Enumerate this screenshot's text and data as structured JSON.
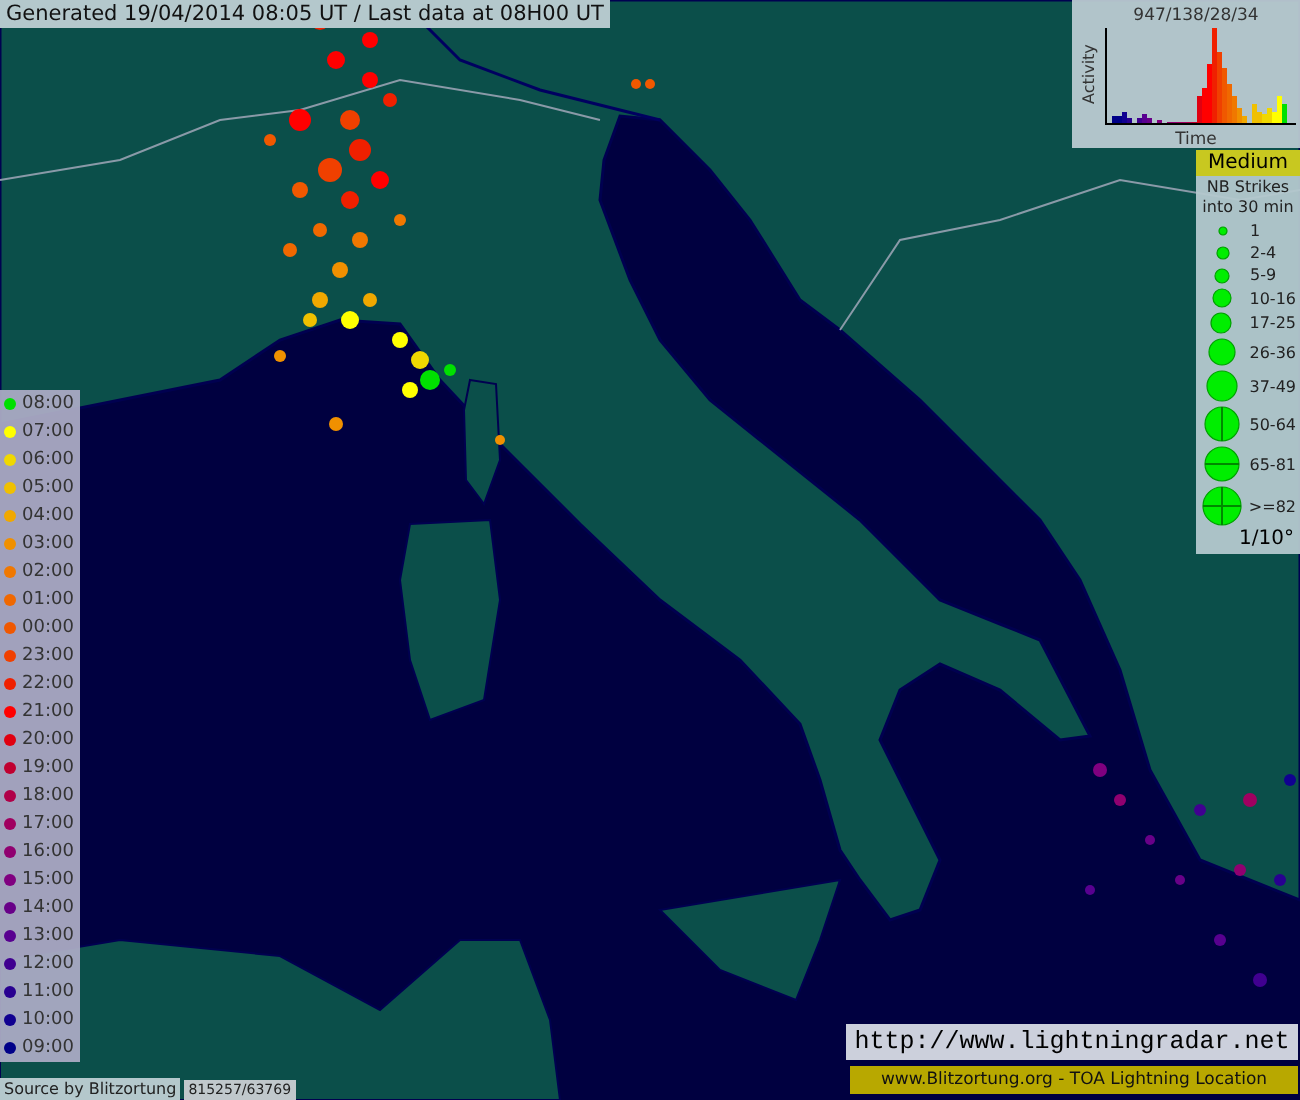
{
  "header": {
    "text": "Generated 19/04/2014 08:05 UT / Last data at 08H00 UT"
  },
  "activity_chart": {
    "title": "947/138/28/34",
    "ylabel": "Activity",
    "xlabel": "Time"
  },
  "size_legend": {
    "level_label": "Medium",
    "title": "NB Strikes into 30 min",
    "grid": "1/10°",
    "items": [
      {
        "label": "1",
        "kind": "plain"
      },
      {
        "label": "2-4",
        "kind": "plain"
      },
      {
        "label": "5-9",
        "kind": "plain"
      },
      {
        "label": "10-16",
        "kind": "plain"
      },
      {
        "label": "17-25",
        "kind": "plain"
      },
      {
        "label": "26-36",
        "kind": "plain"
      },
      {
        "label": "37-49",
        "kind": "plain"
      },
      {
        "label": "50-64",
        "kind": "vertical"
      },
      {
        "label": "65-81",
        "kind": "horizontal"
      },
      {
        "label": ">=82",
        "kind": "cross"
      }
    ]
  },
  "time_legend": [
    {
      "label": "08:00",
      "color": "#00e000"
    },
    {
      "label": "07:00",
      "color": "#ffff00"
    },
    {
      "label": "06:00",
      "color": "#f0d800"
    },
    {
      "label": "05:00",
      "color": "#f0c000"
    },
    {
      "label": "04:00",
      "color": "#f0a800"
    },
    {
      "label": "03:00",
      "color": "#f09000"
    },
    {
      "label": "02:00",
      "color": "#f07800"
    },
    {
      "label": "01:00",
      "color": "#f06800"
    },
    {
      "label": "00:00",
      "color": "#f05800"
    },
    {
      "label": "23:00",
      "color": "#f04000"
    },
    {
      "label": "22:00",
      "color": "#f02000"
    },
    {
      "label": "21:00",
      "color": "#ff0000"
    },
    {
      "label": "20:00",
      "color": "#e00010"
    },
    {
      "label": "19:00",
      "color": "#c00030"
    },
    {
      "label": "18:00",
      "color": "#b00048"
    },
    {
      "label": "17:00",
      "color": "#a00060"
    },
    {
      "label": "16:00",
      "color": "#900070"
    },
    {
      "label": "15:00",
      "color": "#800080"
    },
    {
      "label": "14:00",
      "color": "#680088"
    },
    {
      "label": "13:00",
      "color": "#580090"
    },
    {
      "label": "12:00",
      "color": "#400090"
    },
    {
      "label": "11:00",
      "color": "#280090"
    },
    {
      "label": "10:00",
      "color": "#100090"
    },
    {
      "label": "09:00",
      "color": "#000088"
    }
  ],
  "footer": {
    "source": "Source by Blitzortung",
    "count": "815257/63769",
    "url": "http://www.lightningradar.net",
    "credit": "www.Blitzortung.org - TOA Lightning Location"
  }
}
